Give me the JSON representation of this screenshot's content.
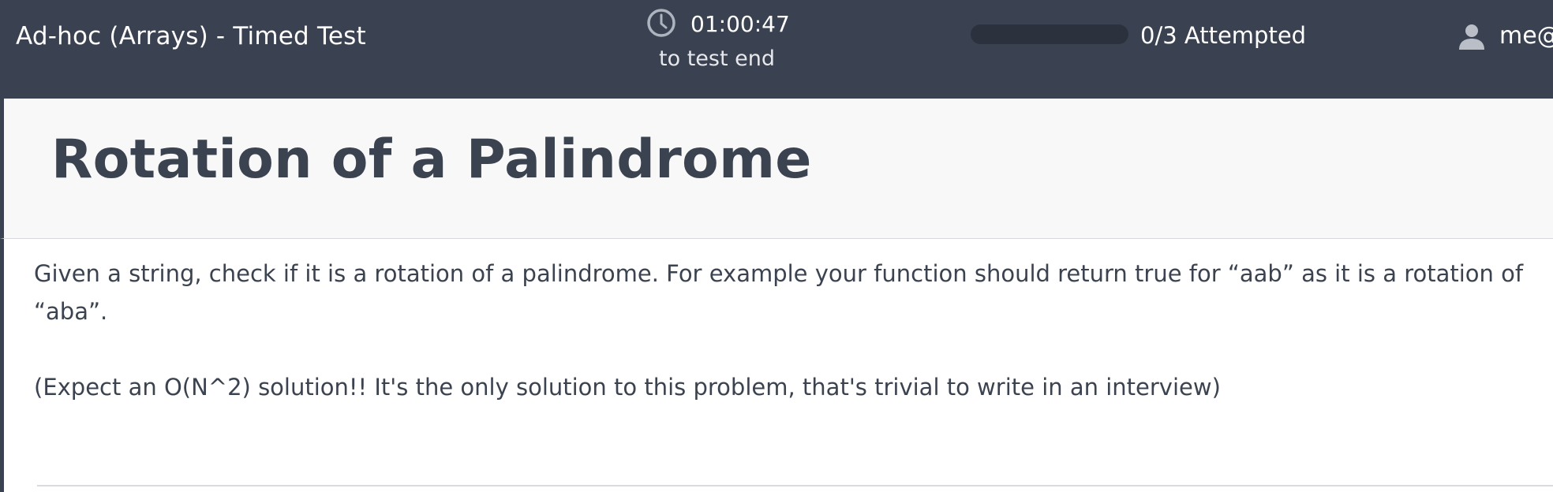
{
  "header": {
    "test_title": "Ad-hoc (Arrays) - Timed Test",
    "timer": {
      "icon": "clock-icon",
      "value": "01:00:47",
      "caption": "to test end"
    },
    "progress": {
      "attempted": 0,
      "total": 3,
      "fraction": 0,
      "label": "0/3 Attempted"
    },
    "user": {
      "icon": "user-icon",
      "name": "me@"
    }
  },
  "problem": {
    "title": "Rotation of a Palindrome",
    "description": "Given a string, check if it is a rotation of a palindrome. For example your function should return true for “aab” as it is a rotation of “aba”.",
    "note": "(Expect an O(N^2) solution!!  It's the only solution to this problem, that's trivial to write in an interview)"
  },
  "colors": {
    "header_bg": "#3a4150",
    "text_dark": "#3c4350",
    "progress_track": "#2b323e",
    "problem_header_bg": "#f8f8f9"
  }
}
